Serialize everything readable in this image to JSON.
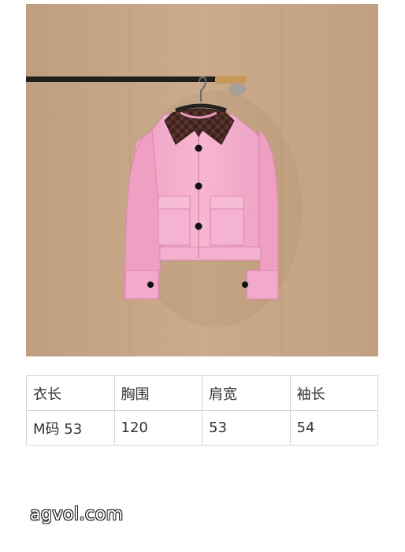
{
  "product_image": {
    "subject": "pink-jacket-with-brown-woven-collar",
    "colors": {
      "wall": "#c6a686",
      "jacket": "#f1aacb",
      "collar": "#4b2a24",
      "rail": "#1f1f1f",
      "bracket": "#c79a5a"
    }
  },
  "size_table": {
    "headers": [
      "衣长",
      "胸围",
      "肩宽",
      "袖长"
    ],
    "rows": [
      [
        "M码 53",
        "120",
        "53",
        "54"
      ]
    ]
  },
  "watermark": "agvol.com"
}
